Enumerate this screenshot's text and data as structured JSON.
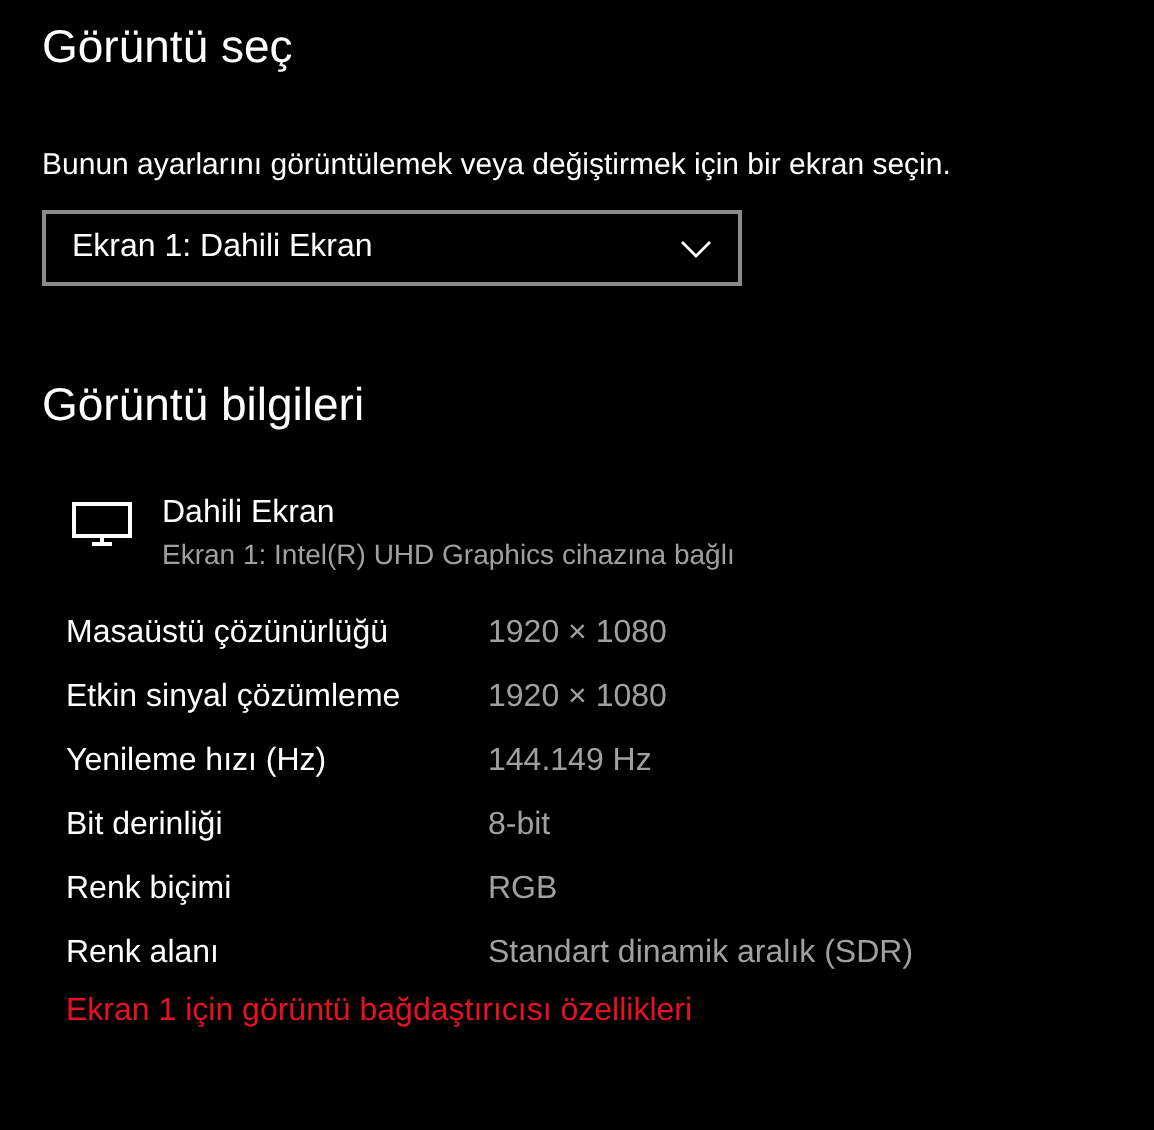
{
  "title": "Görüntü seç",
  "description": "Bunun ayarlarını görüntülemek veya değiştirmek için bir ekran seçin.",
  "display_select": {
    "value": "Ekran 1: Dahili Ekran"
  },
  "info_heading": "Görüntü bilgileri",
  "display": {
    "name": "Dahili Ekran",
    "subtitle": "Ekran 1: Intel(R) UHD Graphics cihazına bağlı"
  },
  "properties": [
    {
      "label": "Masaüstü çözünürlüğü",
      "value": "1920 × 1080"
    },
    {
      "label": "Etkin sinyal çözümleme",
      "value": "1920 × 1080"
    },
    {
      "label": "Yenileme hızı (Hz)",
      "value": "144.149 Hz"
    },
    {
      "label": "Bit derinliği",
      "value": "8-bit"
    },
    {
      "label": "Renk biçimi",
      "value": "RGB"
    },
    {
      "label": "Renk alanı",
      "value": "Standart dinamik aralık (SDR)"
    }
  ],
  "adapter_link": "Ekran 1 için görüntü bağdaştırıcısı özellikleri"
}
